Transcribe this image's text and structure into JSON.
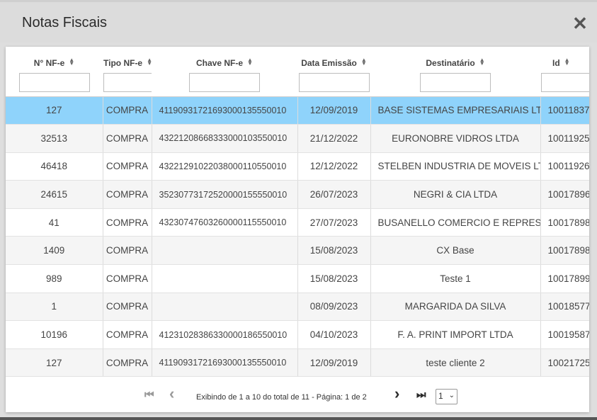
{
  "modal": {
    "title": "Notas Fiscais",
    "close_symbol": "✕"
  },
  "table": {
    "columns": [
      {
        "label": "N° NF-e"
      },
      {
        "label": "Tipo NF-e"
      },
      {
        "label": "Chave NF-e"
      },
      {
        "label": "Data Emissão"
      },
      {
        "label": "Destinatário"
      },
      {
        "label": "Id"
      }
    ],
    "rows": [
      {
        "num": "127",
        "tipo": "COMPRA",
        "chave": "41190931721693000135550010",
        "data": "12/09/2019",
        "dest": "BASE SISTEMAS EMPRESARIAIS LTDA",
        "id": "10011837"
      },
      {
        "num": "32513",
        "tipo": "COMPRA",
        "chave": "43221208668333000103550010",
        "data": "21/12/2022",
        "dest": "EURONOBRE VIDROS LTDA",
        "id": "10011925"
      },
      {
        "num": "46418",
        "tipo": "COMPRA",
        "chave": "43221291022038000110550010",
        "data": "12/12/2022",
        "dest": "STELBEN INDUSTRIA DE MOVEIS LTDA",
        "id": "10011926"
      },
      {
        "num": "24615",
        "tipo": "COMPRA",
        "chave": "35230773172520000155550010",
        "data": "26/07/2023",
        "dest": "NEGRI & CIA LTDA",
        "id": "10017896"
      },
      {
        "num": "41",
        "tipo": "COMPRA",
        "chave": "43230747603260000115550010",
        "data": "27/07/2023",
        "dest": "BUSANELLO COMERCIO E REPRESENTACOES",
        "id": "10017898"
      },
      {
        "num": "1409",
        "tipo": "COMPRA",
        "chave": "",
        "data": "15/08/2023",
        "dest": "CX Base",
        "id": "10017898"
      },
      {
        "num": "989",
        "tipo": "COMPRA",
        "chave": "",
        "data": "15/08/2023",
        "dest": "Teste 1",
        "id": "10017899"
      },
      {
        "num": "1",
        "tipo": "COMPRA",
        "chave": "",
        "data": "08/09/2023",
        "dest": "MARGARIDA DA SILVA",
        "id": "10018577"
      },
      {
        "num": "10196",
        "tipo": "COMPRA",
        "chave": "41231028386330000186550010",
        "data": "04/10/2023",
        "dest": "F. A. PRINT IMPORT LTDA",
        "id": "10019587"
      },
      {
        "num": "127",
        "tipo": "COMPRA",
        "chave": "41190931721693000135550010",
        "data": "12/09/2019",
        "dest": "teste cliente 2",
        "id": "10021725"
      }
    ]
  },
  "pager": {
    "first_symbol": "⏮",
    "prev_symbol": "‹",
    "next_symbol": "›",
    "last_symbol": "⏭",
    "status_text": "Exibindo de 1 a 10 do total de 11 - Página: 1 de 2",
    "page_select_value": "1"
  },
  "colors": {
    "selected_row": "#8fd3fb",
    "header_bg": "#dcdcdc"
  },
  "icons": [
    "close-icon",
    "sort-icon",
    "first-page-icon",
    "prev-page-icon",
    "next-page-icon",
    "last-page-icon",
    "chevron-down-icon"
  ]
}
